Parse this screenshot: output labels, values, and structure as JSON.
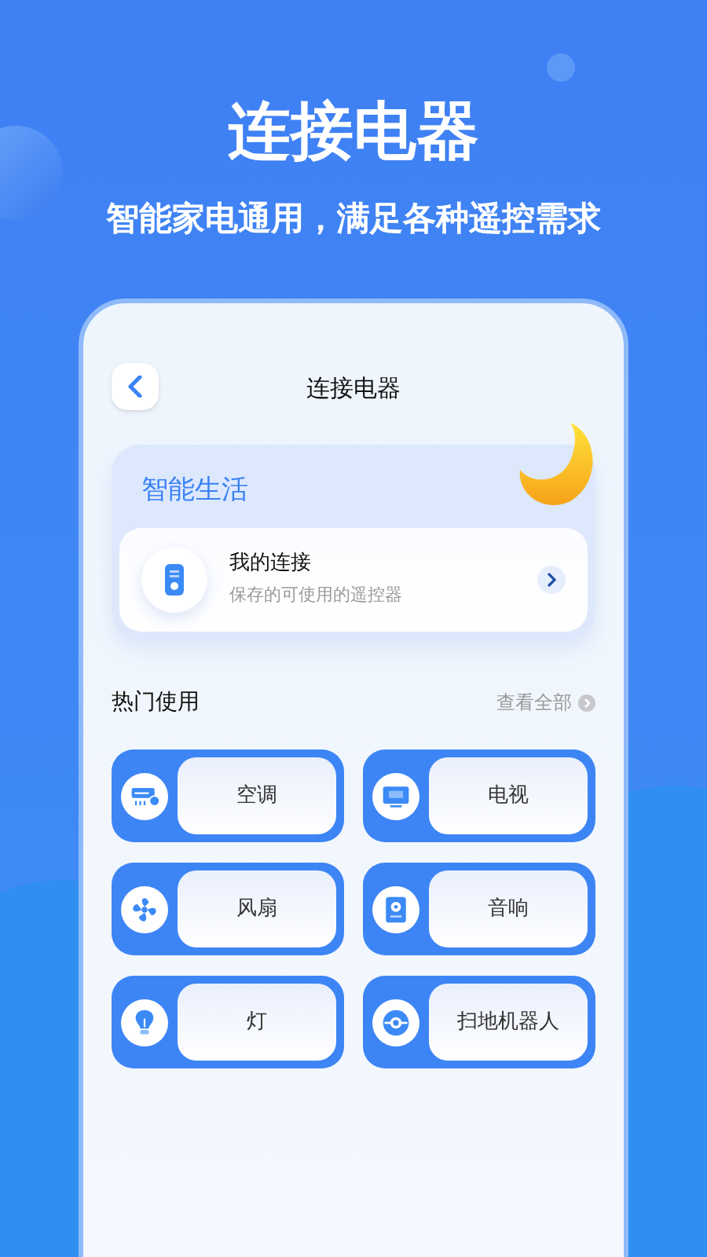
{
  "headline": "连接电器",
  "subtitle": "智能家电通用，满足各种遥控需求",
  "screen": {
    "title": "连接电器",
    "smart_life": {
      "title": "智能生活",
      "entry": {
        "title": "我的连接",
        "subtitle": "保存的可使用的遥控器"
      }
    },
    "hot": {
      "title": "热门使用",
      "view_all": "查看全部",
      "devices": [
        {
          "label": "空调"
        },
        {
          "label": "电视"
        },
        {
          "label": "风扇"
        },
        {
          "label": "音响"
        },
        {
          "label": "灯"
        },
        {
          "label": "扫地机器人"
        }
      ]
    }
  }
}
